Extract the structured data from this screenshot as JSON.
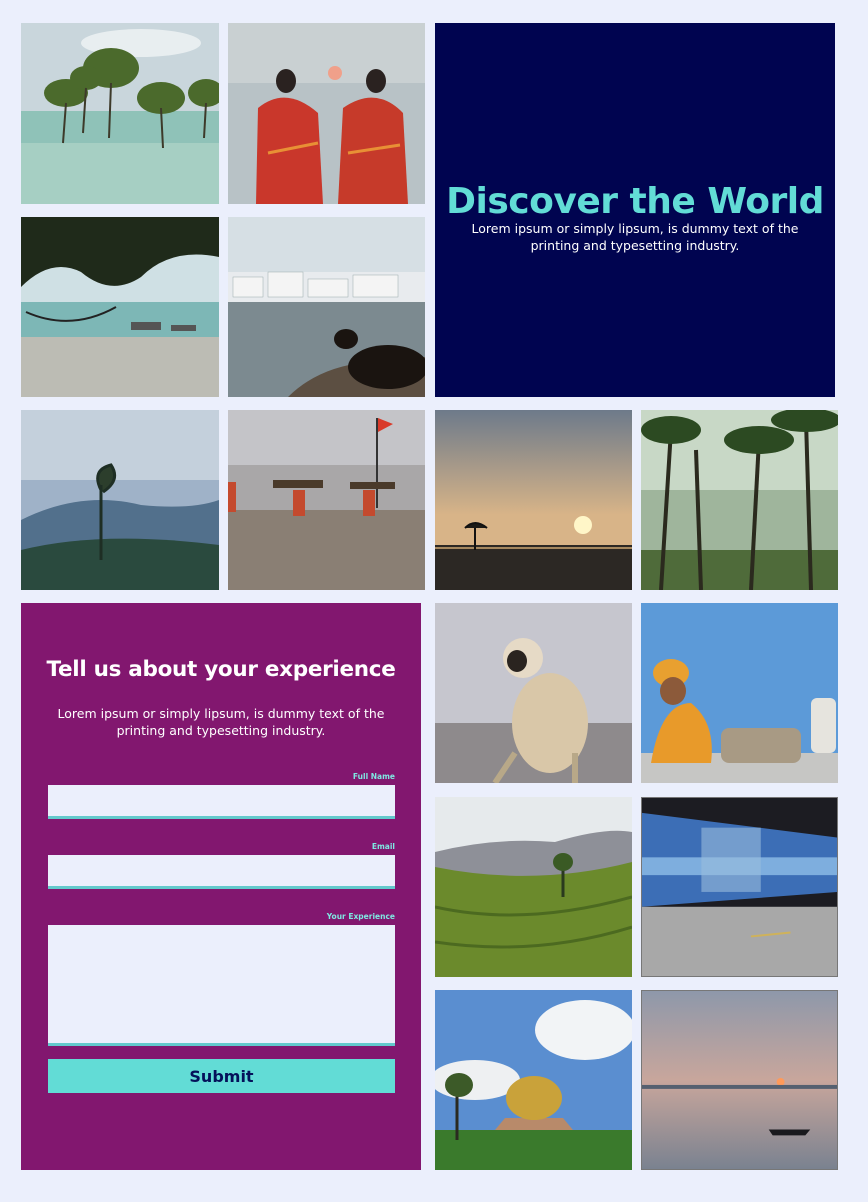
{
  "hero": {
    "title": "Discover the World",
    "text": "Lorem ipsum or simply lipsum, is dummy text of the printing and typesetting industry."
  },
  "form": {
    "title": "Tell us about your experience",
    "text": "Lorem ipsum or simply lipsum, is dummy text of the printing and typesetting industry.",
    "full_name_label": "Full Name",
    "email_label": "Email",
    "experience_label": "Your Experience",
    "submit_label": "Submit",
    "full_name_value": "",
    "email_value": "",
    "experience_value": ""
  },
  "colors": {
    "page_background": "#ebeffc",
    "hero_background": "#000450",
    "hero_title": "#62dcd6",
    "form_background": "#82176f",
    "form_label": "#7fe8e2",
    "submit_background": "#62dcd6",
    "submit_text": "#04115a"
  },
  "gallery": [
    {
      "subject": "mangrove-trees-in-sea"
    },
    {
      "subject": "two-women-in-red-saris-at-sunset"
    },
    {
      "subject": "hammock-under-tree-on-beach"
    },
    {
      "subject": "cow-at-lake-with-white-town"
    },
    {
      "subject": "misty-blue-hills"
    },
    {
      "subject": "people-carrying-wood-on-beach"
    },
    {
      "subject": "sunset-over-tidal-flat"
    },
    {
      "subject": "coconut-palm-forest"
    },
    {
      "subject": "langur-monkey"
    },
    {
      "subject": "sadhu-against-blue-wall"
    },
    {
      "subject": "tea-plantation-hills"
    },
    {
      "subject": "blurred-blue-train"
    },
    {
      "subject": "golden-dome-matrimandir"
    },
    {
      "subject": "boat-on-lake-at-dusk"
    }
  ]
}
